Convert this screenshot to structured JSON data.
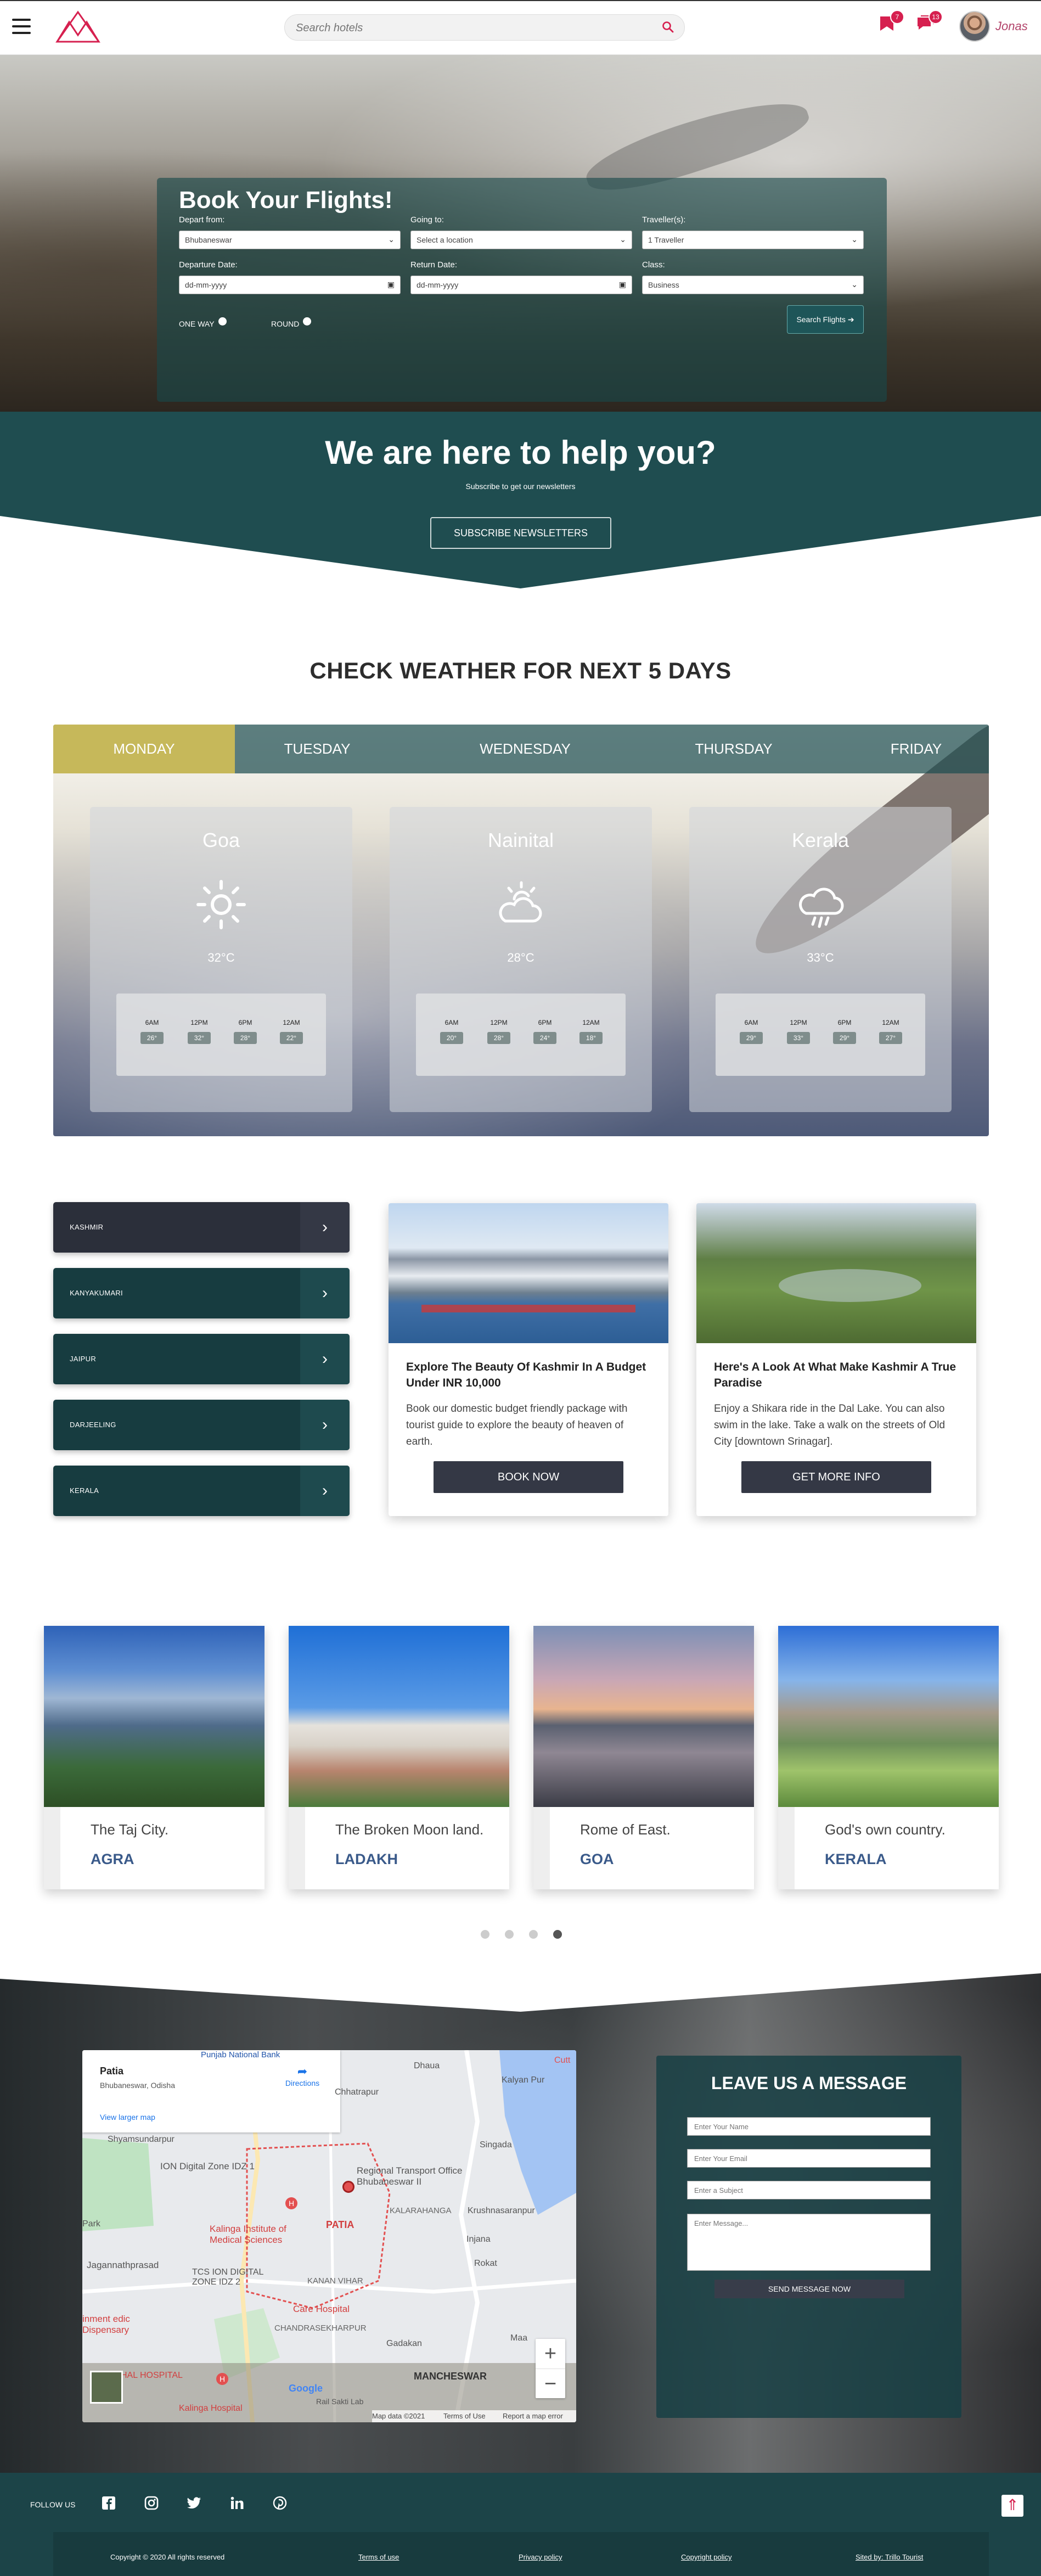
{
  "header": {
    "search_placeholder": "Search hotels",
    "notif_badge_1": "7",
    "notif_badge_2": "13",
    "username": "Jonas"
  },
  "hero": {
    "title": "Book Your Flights!",
    "depart_label": "Depart from:",
    "depart_value": "Bhubaneswar",
    "going_label": "Going to:",
    "going_value": "Select a location",
    "traveller_label": "Traveller(s):",
    "traveller_value": "1 Traveller",
    "departure_date_label": "Departure Date:",
    "departure_date_placeholder": "dd-mm-yyyy",
    "return_date_label": "Return Date:",
    "return_date_placeholder": "dd-mm-yyyy",
    "class_label": "Class:",
    "class_value": "Business",
    "one_way": "ONE WAY",
    "round": "ROUND",
    "search_button": "Search Flights"
  },
  "help": {
    "title": "We are here to help you?",
    "subtitle": "Subscribe to get our newsletters",
    "button": "SUBSCRIBE NEWSLETTERS"
  },
  "weather": {
    "title": "CHECK WEATHER FOR NEXT 5 DAYS",
    "tabs": [
      "MONDAY",
      "TUESDAY",
      "WEDNESDAY",
      "THURSDAY",
      "FRIDAY"
    ],
    "cities": [
      {
        "name": "Goa",
        "icon": "sun-icon",
        "temp": "32°C",
        "hours": [
          "6AM",
          "12PM",
          "6PM",
          "12AM"
        ],
        "values": [
          "26°",
          "32°",
          "28°",
          "22°"
        ]
      },
      {
        "name": "Nainital",
        "icon": "cloud-sun-icon",
        "temp": "28°C",
        "hours": [
          "6AM",
          "12PM",
          "6PM",
          "12AM"
        ],
        "values": [
          "20°",
          "28°",
          "24°",
          "18°"
        ]
      },
      {
        "name": "Kerala",
        "icon": "cloud-rain-icon",
        "temp": "33°C",
        "hours": [
          "6AM",
          "12PM",
          "6PM",
          "12AM"
        ],
        "values": [
          "29°",
          "33°",
          "29°",
          "27°"
        ]
      }
    ]
  },
  "destinations": [
    "KASHMIR",
    "KANYAKUMARI",
    "JAIPUR",
    "DARJEELING",
    "KERALA"
  ],
  "cards": [
    {
      "title": "Explore The Beauty Of Kashmir In A Budget Under INR 10,000",
      "desc": "Book our domestic budget friendly package with tourist guide to explore the beauty of heaven of earth.",
      "button": "BOOK NOW"
    },
    {
      "title": "Here's A Look At What Make Kashmir A True Paradise",
      "desc": "Enjoy a Shikara ride in the Dal Lake. You can also swim in the lake. Take a walk on the streets of Old City [downtown Srinagar].",
      "button": "GET MORE INFO"
    }
  ],
  "tours": [
    {
      "caption": "The Taj City.",
      "name": "AGRA"
    },
    {
      "caption": "The Broken Moon land.",
      "name": "LADAKH"
    },
    {
      "caption": "Rome of East.",
      "name": "GOA"
    },
    {
      "caption": "God's own country.",
      "name": "KERALA"
    }
  ],
  "map": {
    "place": "Patia",
    "region": "Bhubaneswar, Odisha",
    "directions": "Directions",
    "larger": "View larger map",
    "labels": [
      "Punjab National Bank",
      "Dhaua",
      "Kalyan Pur",
      "Cutt",
      "Shyamsundarpur",
      "Chhatrapur",
      "ION Digital Zone IDZ 1",
      "Regional Transport Office Bhubaneswar II",
      "Singada",
      "Park",
      "Kalinga Institute of Medical Sciences",
      "PATIA",
      "KALARAHANGA",
      "Krushnasaranpur",
      "Jagannathprasad",
      "TCS ION DIGITAL ZONE IDZ 2",
      "KANAN VIHAR",
      "Injana",
      "Rokat",
      "inment edic Dispensary",
      "Care Hospital",
      "CHANDRASEKHARPUR",
      "Gadakan",
      "Maa",
      "HAL HOSPITAL",
      "MANCHESWAR",
      "Kalinga Hospital",
      "Rail Sakti Lab"
    ],
    "footer": [
      "Map data ©2021",
      "Terms of Use",
      "Report a map error"
    ],
    "google": "Google"
  },
  "message": {
    "title": "LEAVE US A MESSAGE",
    "name": "Enter Your Name",
    "email": "Enter Your Email",
    "subject": "Enter a Subject",
    "message": "Enter Message...",
    "button": "SEND MESSAGE NOW"
  },
  "footer": {
    "follow": "FOLLOW US",
    "copyright": "Copyright © 2020 All rights reserved",
    "terms": "Terms of use",
    "privacy": "Privacy policy",
    "copyright_policy": "Copyright policy",
    "sited": "Sited by: Trillo Tourist"
  }
}
